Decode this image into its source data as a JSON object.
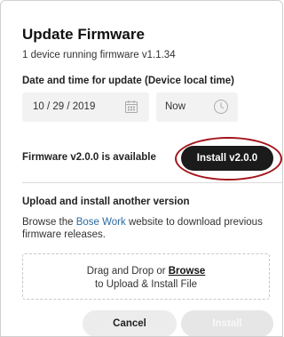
{
  "dialog": {
    "title": "Update Firmware",
    "subtitle": "1 device running firmware v1.1.34"
  },
  "schedule": {
    "label": "Date and time for update (Device local time)",
    "date_value": "10 / 29 / 2019",
    "time_value": "Now",
    "date_icon": "calendar-icon",
    "time_icon": "clock-icon"
  },
  "available": {
    "label": "Firmware v2.0.0 is available",
    "install_label": "Install v2.0.0",
    "install_bg": "#1b1b1b",
    "highlight_color": "#a3151b"
  },
  "upload": {
    "label": "Upload and install another version",
    "browse_prefix": "Browse the ",
    "browse_link": "Bose Work",
    "browse_suffix": " website to download previous firmware releases.",
    "link_color": "#2b6aa0",
    "drop_prefix": "Drag and Drop or ",
    "drop_browse": "Browse",
    "drop_line2": "to Upload & Install File"
  },
  "footer": {
    "cancel_label": "Cancel",
    "install_label": "Install"
  }
}
